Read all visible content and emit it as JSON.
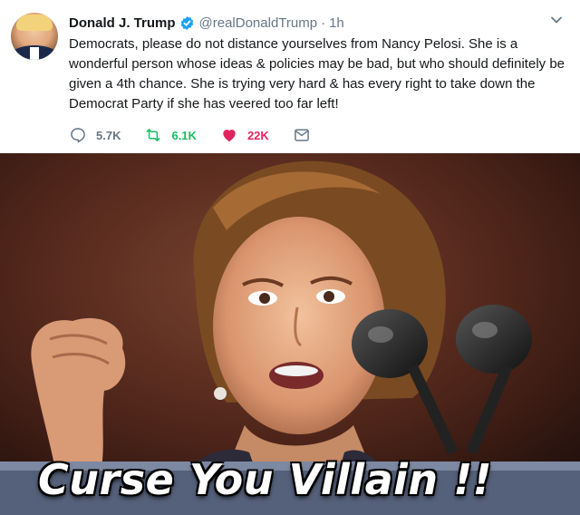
{
  "tweet": {
    "author_name": "Donald J. Trump",
    "author_handle": "@realDonaldTrump",
    "separator": "·",
    "timestamp": "1h",
    "text": "Democrats, please do not distance yourselves from Nancy Pelosi. She is a wonderful person whose ideas & policies may be bad, but who should definitely be given a 4th chance. She is trying very hard & has every right to take down the Democrat Party if she has veered too far left!",
    "verified": true
  },
  "actions": {
    "reply_count": "5.7K",
    "retweet_count": "6.1K",
    "like_count": "22K"
  },
  "media": {
    "caption": "Curse You Villain !!"
  },
  "colors": {
    "text": "#14171a",
    "muted": "#657786",
    "verified_blue": "#1da1f2",
    "retweet_green": "#17bf63",
    "like_red": "#e0245e"
  },
  "icons": [
    "avatar",
    "verified-badge-icon",
    "chevron-down-icon",
    "reply-icon",
    "retweet-icon",
    "heart-icon",
    "message-icon"
  ]
}
